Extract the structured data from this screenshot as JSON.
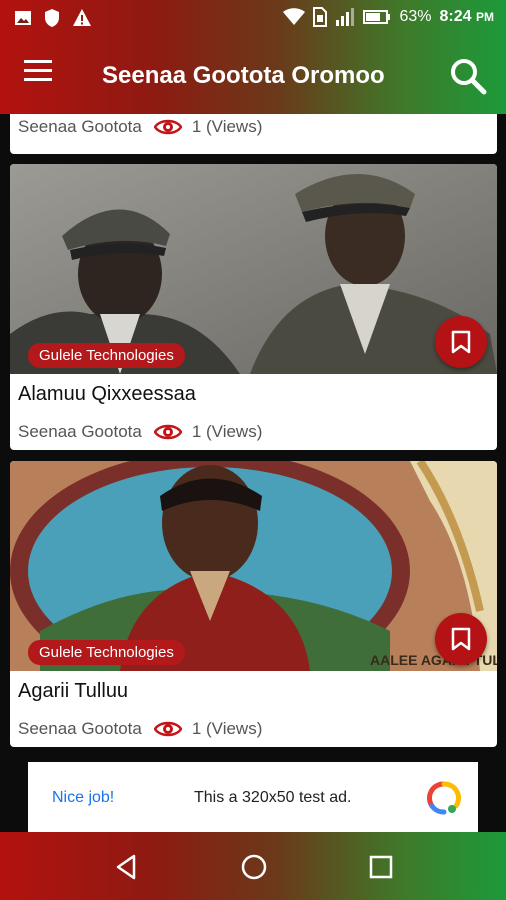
{
  "status": {
    "battery": "63%",
    "time": "8:24",
    "ampm": "PM"
  },
  "appbar": {
    "title": "Seenaa Gootota Oromoo"
  },
  "cards": [
    {
      "title": "",
      "source": "Seenaa Gootota",
      "views": "1 (Views)",
      "badge": ""
    },
    {
      "title": "Alamuu Qixxeessaa",
      "source": "Seenaa Gootota",
      "views": "1 (Views)",
      "badge": "Gulele Technologies"
    },
    {
      "title": "Agarii Tulluu",
      "source": "Seenaa Gootota",
      "views": "1 (Views)",
      "badge": "Gulele Technologies",
      "image_caption": "AALEE AGARII TULLU"
    }
  ],
  "ad": {
    "label": "Nice job!",
    "text": "This a 320x50 test ad."
  },
  "colors": {
    "brand_red": "#b3120f",
    "brand_green": "#1c9a3a",
    "accent": "#b41215"
  }
}
